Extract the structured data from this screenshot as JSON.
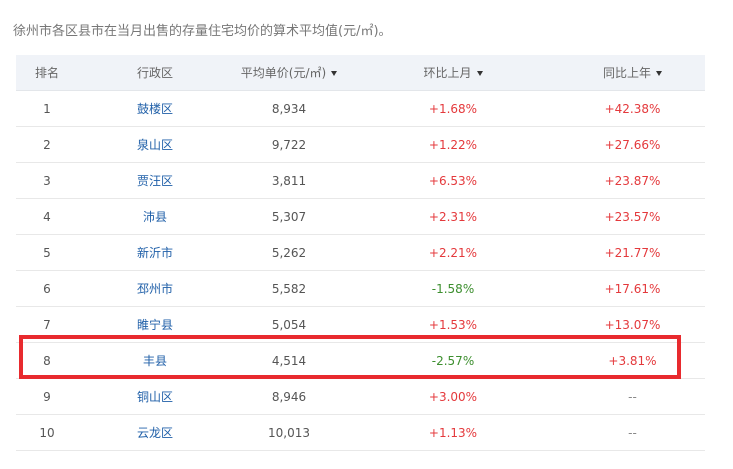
{
  "caption": "徐州市各区县市在当月出售的存量住宅均价的算术平均值(元/㎡)。",
  "headers": {
    "rank": "排名",
    "district": "行政区",
    "price": "平均单价(元/㎡)",
    "mom": "环比上月",
    "yoy": "同比上年"
  },
  "icons": {
    "sort": "sort-down-caret-icon"
  },
  "colors": {
    "up": "#e4393c",
    "down": "#3d8f2f",
    "link": "#1f5fa8",
    "highlight_box": "#e82a2e"
  },
  "rows": [
    {
      "rank": "1",
      "district": "鼓楼区",
      "price": "8,934",
      "mom": "+1.68%",
      "yoy": "+42.38%"
    },
    {
      "rank": "2",
      "district": "泉山区",
      "price": "9,722",
      "mom": "+1.22%",
      "yoy": "+27.66%"
    },
    {
      "rank": "3",
      "district": "贾汪区",
      "price": "3,811",
      "mom": "+6.53%",
      "yoy": "+23.87%"
    },
    {
      "rank": "4",
      "district": "沛县",
      "price": "5,307",
      "mom": "+2.31%",
      "yoy": "+23.57%"
    },
    {
      "rank": "5",
      "district": "新沂市",
      "price": "5,262",
      "mom": "+2.21%",
      "yoy": "+21.77%"
    },
    {
      "rank": "6",
      "district": "邳州市",
      "price": "5,582",
      "mom": "-1.58%",
      "yoy": "+17.61%"
    },
    {
      "rank": "7",
      "district": "睢宁县",
      "price": "5,054",
      "mom": "+1.53%",
      "yoy": "+13.07%"
    },
    {
      "rank": "8",
      "district": "丰县",
      "price": "4,514",
      "mom": "-2.57%",
      "yoy": "+3.81%"
    },
    {
      "rank": "9",
      "district": "铜山区",
      "price": "8,946",
      "mom": "+3.00%",
      "yoy": "--"
    },
    {
      "rank": "10",
      "district": "云龙区",
      "price": "10,013",
      "mom": "+1.13%",
      "yoy": "--"
    }
  ]
}
